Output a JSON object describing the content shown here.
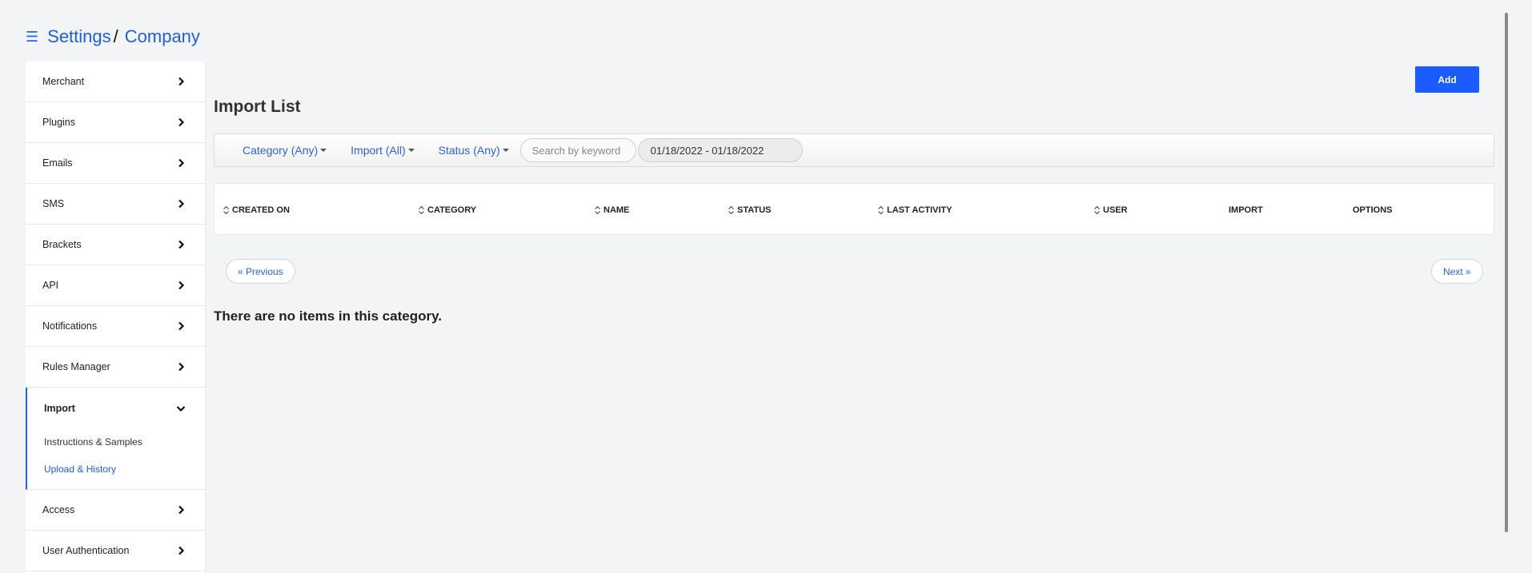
{
  "breadcrumb": {
    "items": [
      "Settings",
      "Company"
    ],
    "separator": "/"
  },
  "sidebar": {
    "items": [
      {
        "label": "Merchant"
      },
      {
        "label": "Plugins"
      },
      {
        "label": "Emails"
      },
      {
        "label": "SMS"
      },
      {
        "label": "Brackets"
      },
      {
        "label": "API"
      },
      {
        "label": "Notifications"
      },
      {
        "label": "Rules Manager"
      }
    ],
    "open_section": {
      "label": "Import",
      "children": [
        "Instructions & Samples",
        "Upload & History"
      ],
      "active_child": "Upload & History"
    },
    "items_after": [
      {
        "label": "Access"
      },
      {
        "label": "User Authentication"
      }
    ]
  },
  "toolbar": {
    "add_label": "Add"
  },
  "page": {
    "title": "Import List"
  },
  "filters": {
    "category": "Category (Any)",
    "import": "Import (All)",
    "status": "Status (Any)",
    "search_placeholder": "Search by keyword",
    "date_range": "01/18/2022 - 01/18/2022"
  },
  "table": {
    "columns": [
      "CREATED ON",
      "CATEGORY",
      "NAME",
      "STATUS",
      "LAST ACTIVITY",
      "USER",
      "IMPORT",
      "OPTIONS"
    ]
  },
  "pager": {
    "previous": "« Previous",
    "next": "Next »"
  },
  "empty_message": "There are no items in this category.",
  "colors": {
    "accent": "#1a5cff",
    "link": "#1f5fe0"
  }
}
